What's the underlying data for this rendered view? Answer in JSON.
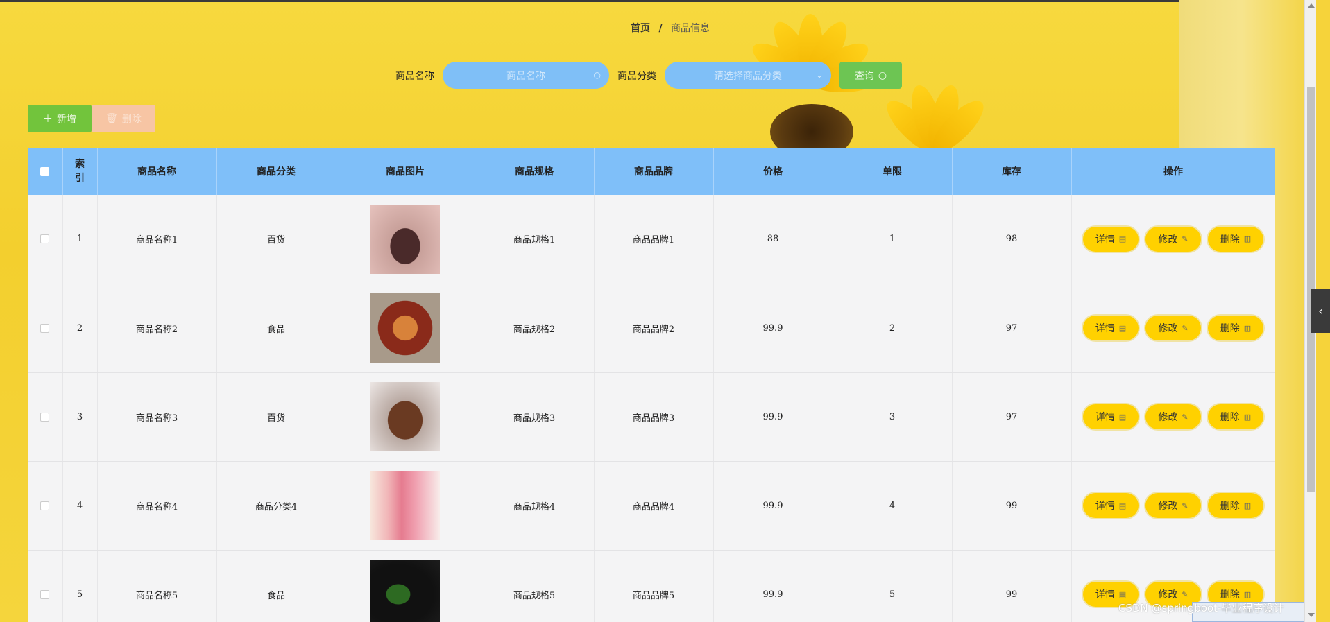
{
  "breadcrumb": {
    "home": "首页",
    "separator": "/",
    "current": "商品信息"
  },
  "search": {
    "name_label": "商品名称",
    "name_placeholder": "商品名称",
    "category_label": "商品分类",
    "category_placeholder": "请选择商品分类",
    "query_label": "查询"
  },
  "actions": {
    "add_label": "新增",
    "delete_label": "删除"
  },
  "table": {
    "headers": [
      "索引",
      "商品名称",
      "商品分类",
      "商品图片",
      "商品规格",
      "商品品牌",
      "价格",
      "单限",
      "库存",
      "操作"
    ],
    "rows": [
      {
        "index": "1",
        "name": "商品名称1",
        "category": "百货",
        "spec": "商品规格1",
        "brand": "商品品牌1",
        "price": "88",
        "limit": "1",
        "stock": "98"
      },
      {
        "index": "2",
        "name": "商品名称2",
        "category": "食品",
        "spec": "商品规格2",
        "brand": "商品品牌2",
        "price": "99.9",
        "limit": "2",
        "stock": "97"
      },
      {
        "index": "3",
        "name": "商品名称3",
        "category": "百货",
        "spec": "商品规格3",
        "brand": "商品品牌3",
        "price": "99.9",
        "limit": "3",
        "stock": "97"
      },
      {
        "index": "4",
        "name": "商品名称4",
        "category": "商品分类4",
        "spec": "商品规格4",
        "brand": "商品品牌4",
        "price": "99.9",
        "limit": "4",
        "stock": "99"
      },
      {
        "index": "5",
        "name": "商品名称5",
        "category": "食品",
        "spec": "商品规格5",
        "brand": "商品品牌5",
        "price": "99.9",
        "limit": "5",
        "stock": "99"
      }
    ],
    "row_actions": {
      "detail": "详情",
      "edit": "修改",
      "delete": "删除"
    }
  },
  "watermark": "CSDN @springboot-毕业程序设计",
  "colors": {
    "header_bg": "#7fbff9",
    "action_button": "#ffd100",
    "add_button": "#72c43c",
    "delete_button": "#f7c5a4",
    "query_button": "#6dc553"
  }
}
